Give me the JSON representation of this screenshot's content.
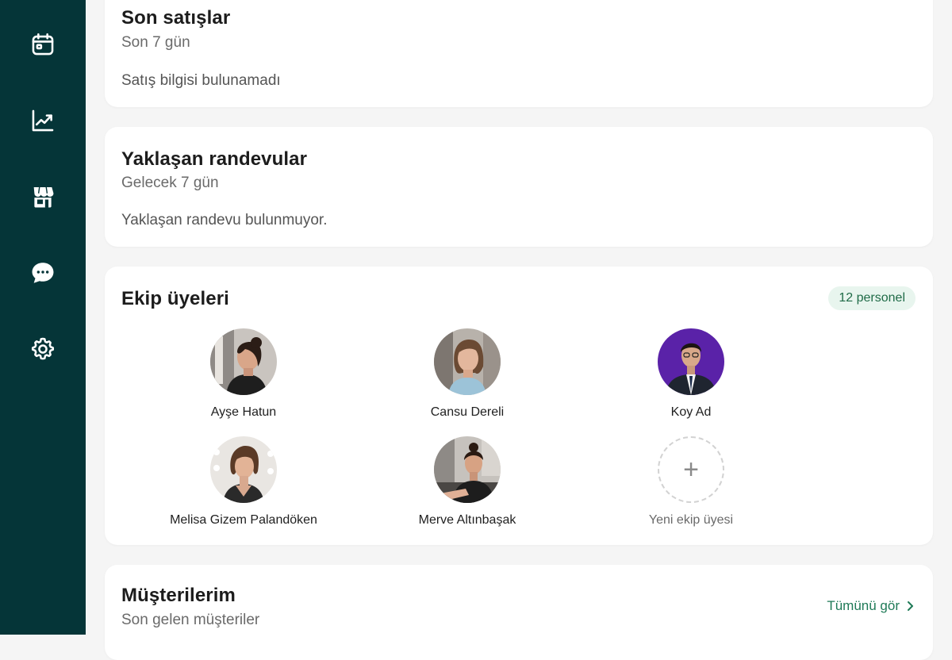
{
  "sidebar": {
    "items": [
      {
        "icon": "calendar-icon"
      },
      {
        "icon": "chart-icon"
      },
      {
        "icon": "store-icon"
      },
      {
        "icon": "chat-icon"
      },
      {
        "icon": "gear-icon"
      }
    ]
  },
  "sales": {
    "title": "Son satışlar",
    "subtitle": "Son 7 gün",
    "empty": "Satış bilgisi bulunamadı"
  },
  "appointments": {
    "title": "Yaklaşan randevular",
    "subtitle": "Gelecek 7 gün",
    "empty": "Yaklaşan randevu bulunmuyor."
  },
  "team": {
    "title": "Ekip üyeleri",
    "badge": "12 personel",
    "members": [
      {
        "name": "Ayşe Hatun"
      },
      {
        "name": "Cansu Dereli"
      },
      {
        "name": "Koy Ad"
      },
      {
        "name": "Melisa Gizem Palandöken"
      },
      {
        "name": "Merve Altınbaşak"
      }
    ],
    "add_label": "Yeni ekip üyesi"
  },
  "customers": {
    "title": "Müşterilerim",
    "subtitle": "Son gelen müşteriler",
    "see_all": "Tümünü gör"
  },
  "colors": {
    "sidebar_bg": "#053538",
    "accent": "#1f7a57",
    "badge_bg": "#e8f5ee"
  }
}
